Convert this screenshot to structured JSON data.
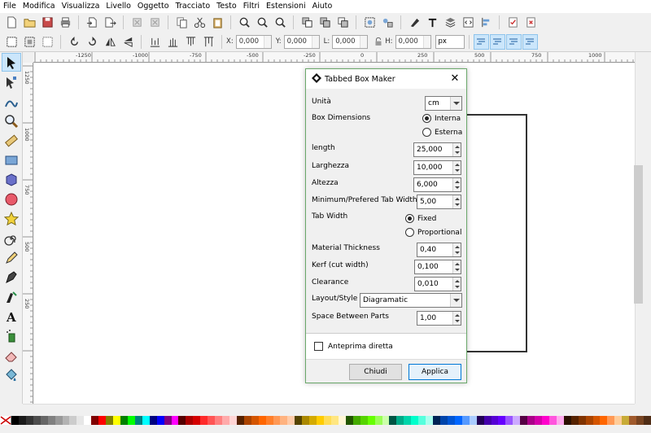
{
  "menu": [
    "File",
    "Modifica",
    "Visualizza",
    "Livello",
    "Oggetto",
    "Tracciato",
    "Testo",
    "Filtri",
    "Estensioni",
    "Aiuto"
  ],
  "toolbar_fields": {
    "x_label": "X:",
    "x_value": "0,000",
    "y_label": "Y:",
    "y_value": "0,000",
    "l_label": "L:",
    "l_value": "0,000",
    "h_label": "H:",
    "h_value": "0,000",
    "unit": "px"
  },
  "ruler": {
    "h_labels": [
      "-1250",
      "-1000",
      "-750",
      "-500",
      "-250",
      "0",
      "250",
      "500",
      "750",
      "1000"
    ],
    "v_labels": [
      "1250",
      "1000",
      "750",
      "500",
      "250"
    ]
  },
  "dialog": {
    "title": "Tabbed Box Maker",
    "units_label": "Unità",
    "units_value": "cm",
    "box_dimensions_label": "Box Dimensions",
    "box_internal": "Interna",
    "box_external": "Esterna",
    "fields": [
      {
        "label": "length",
        "value": "25,000"
      },
      {
        "label": "Larghezza",
        "value": "10,000"
      },
      {
        "label": "Altezza",
        "value": "6,000"
      },
      {
        "label": "Minimum/Prefered Tab Width",
        "value": "5,00"
      }
    ],
    "tab_width_label": "Tab Width",
    "tab_fixed": "Fixed",
    "tab_proportional": "Proportional",
    "fields2": [
      {
        "label": "Material Thickness",
        "value": "0,40"
      },
      {
        "label": "Kerf (cut width)",
        "value": "0,100"
      },
      {
        "label": "Clearance",
        "value": "0,010"
      }
    ],
    "layout_label": "Layout/Style",
    "layout_value": "Diagramatic",
    "space_label": "Space Between Parts",
    "space_value": "1,00",
    "preview_label": "Anteprima diretta",
    "close_button": "Chiudi",
    "apply_button": "Applica"
  },
  "colors": {
    "accent": "#0078d7",
    "dialog_border": "#6aa86a",
    "tool_active": "#cbe6fb"
  },
  "icons": [
    "new-document-icon",
    "open-icon",
    "save-icon",
    "print-icon",
    "import-icon",
    "export-icon",
    "undo-icon",
    "redo-icon",
    "copy-icon",
    "cut-icon",
    "paste-icon",
    "zoom-selection-icon",
    "zoom-drawing-icon",
    "zoom-page-icon",
    "duplicate-icon",
    "clone-icon",
    "unlink-clone-icon",
    "group-icon",
    "ungroup-icon",
    "fill-stroke-icon",
    "text-font-icon",
    "layers-icon",
    "xml-editor-icon",
    "align-icon",
    "preferences-icon",
    "document-properties-icon"
  ]
}
